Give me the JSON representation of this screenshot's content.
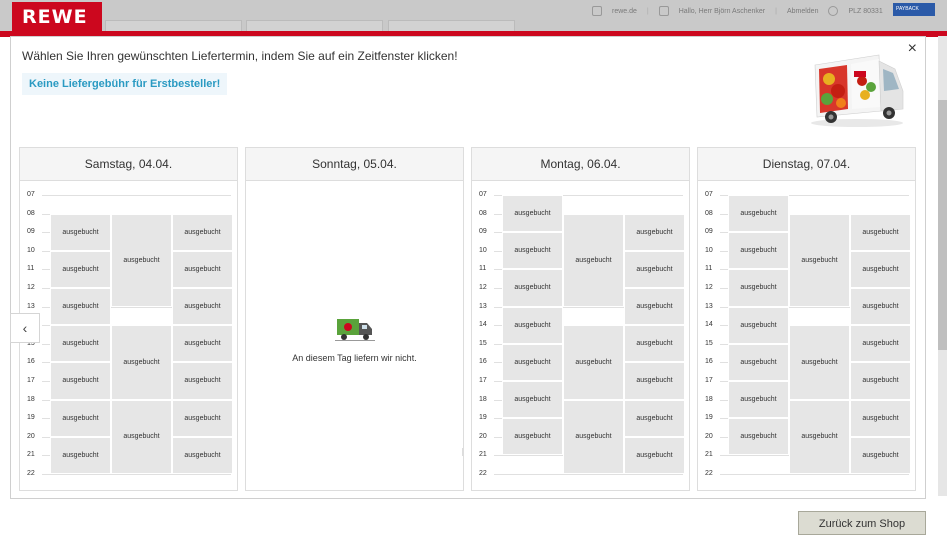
{
  "header": {
    "logo_text": "REWE",
    "links": [
      "rewe.de",
      "Hallo, Herr Björn Aschenker",
      "Abmelden",
      "PLZ 80331"
    ],
    "payback_label": "PAYBACK"
  },
  "modal": {
    "instruction": "Wählen Sie Ihren gewünschten Liefertermin, indem Sie auf ein Zeitfenster klicken!",
    "promo": "Keine Liefergebühr für Erstbesteller!",
    "close_label": "×"
  },
  "hours": [
    "07",
    "08",
    "09",
    "10",
    "11",
    "12",
    "13",
    "14",
    "15",
    "16",
    "17",
    "18",
    "19",
    "20",
    "21",
    "22"
  ],
  "slot_label": "ausgebucht",
  "days": [
    {
      "title": "Samstag, 04.04.",
      "delivers": true
    },
    {
      "title": "Sonntag, 05.04.",
      "delivers": false,
      "message": "An diesem Tag liefern wir nicht."
    },
    {
      "title": "Montag, 06.04.",
      "delivers": true
    },
    {
      "title": "Dienstag, 07.04.",
      "delivers": true
    }
  ],
  "columns": {
    "left_saturday": [
      [
        8,
        10
      ],
      [
        10,
        12
      ],
      [
        12,
        14
      ],
      [
        14,
        16
      ],
      [
        16,
        18
      ],
      [
        18,
        20
      ],
      [
        20,
        22
      ]
    ],
    "left_weekday": [
      [
        7,
        9
      ],
      [
        9,
        11
      ],
      [
        11,
        13
      ],
      [
        13,
        15
      ],
      [
        15,
        17
      ],
      [
        17,
        19
      ],
      [
        19,
        21
      ]
    ],
    "middle_saturday": [
      [
        8,
        13
      ],
      [
        14,
        18
      ],
      [
        18,
        22
      ]
    ],
    "middle_weekday": [
      [
        8,
        13
      ],
      [
        14,
        18
      ],
      [
        18,
        22
      ]
    ],
    "right": [
      [
        8,
        10
      ],
      [
        10,
        12
      ],
      [
        12,
        14
      ],
      [
        14,
        16
      ],
      [
        16,
        18
      ],
      [
        18,
        20
      ],
      [
        20,
        22
      ]
    ]
  },
  "colors": {
    "accent_red": "#cc071e",
    "promo_blue": "#2a9ac2",
    "slot_gray": "#e6e6e6"
  },
  "footer": {
    "back_button": "Zurück zum Shop"
  },
  "nav": {
    "prev_icon": "‹"
  }
}
